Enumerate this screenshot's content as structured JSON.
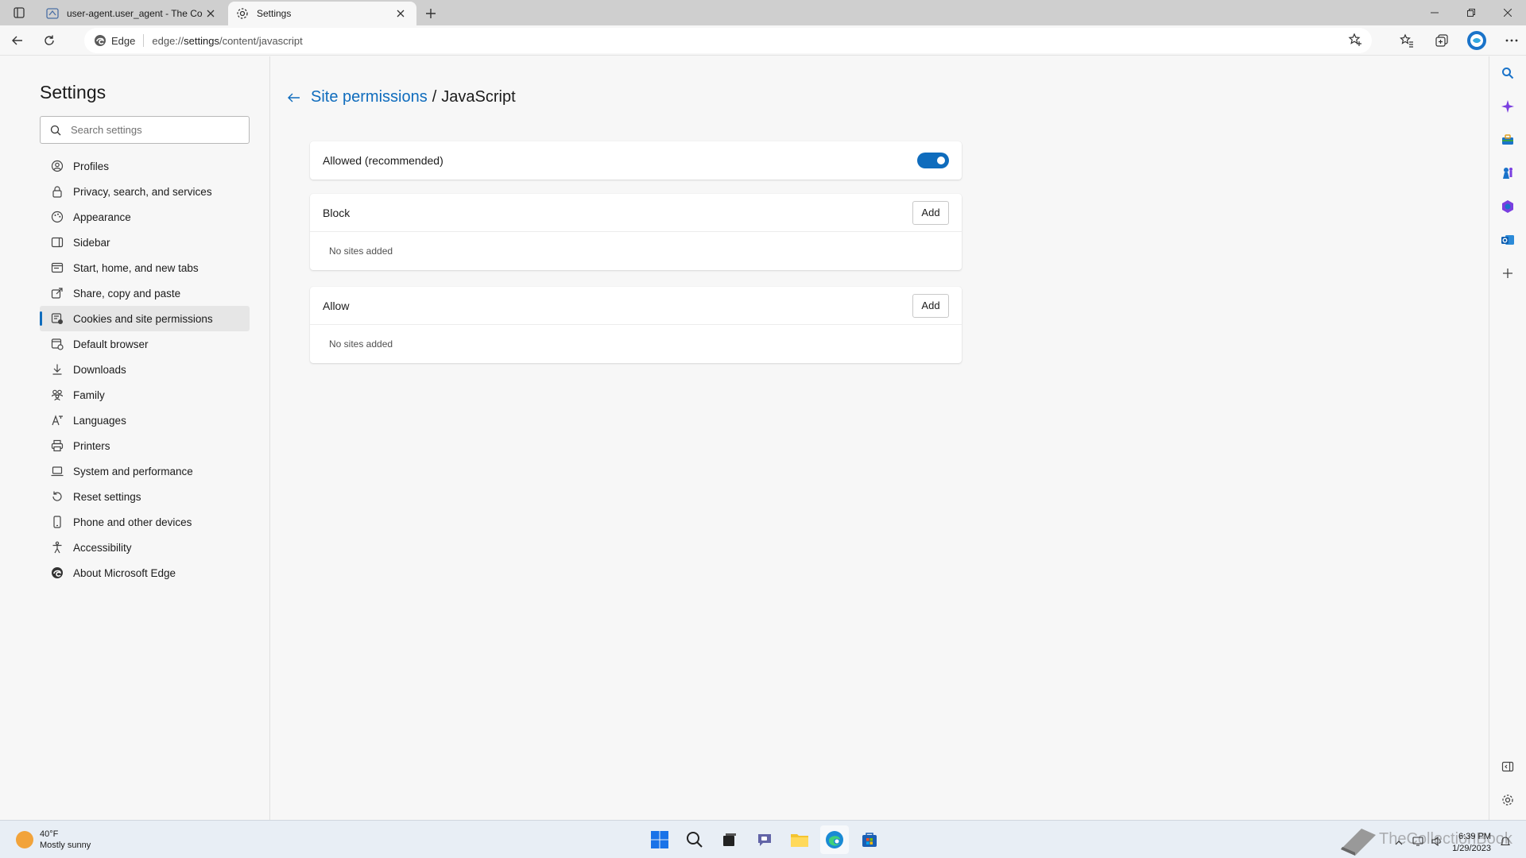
{
  "browser": {
    "tabs": [
      {
        "title": "user-agent.user_agent - The Coll",
        "active": false
      },
      {
        "title": "Settings",
        "active": true
      }
    ],
    "address": {
      "site_label": "Edge",
      "url_prefix": "edge://",
      "url_host": "settings",
      "url_path": "/content/javascript"
    }
  },
  "settings": {
    "title": "Settings",
    "search_placeholder": "Search settings",
    "nav": [
      {
        "label": "Profiles",
        "icon": "profile-icon"
      },
      {
        "label": "Privacy, search, and services",
        "icon": "lock-icon"
      },
      {
        "label": "Appearance",
        "icon": "appearance-icon"
      },
      {
        "label": "Sidebar",
        "icon": "sidebar-icon"
      },
      {
        "label": "Start, home, and new tabs",
        "icon": "home-icon"
      },
      {
        "label": "Share, copy and paste",
        "icon": "share-icon"
      },
      {
        "label": "Cookies and site permissions",
        "icon": "cookies-icon",
        "selected": true
      },
      {
        "label": "Default browser",
        "icon": "browser-icon"
      },
      {
        "label": "Downloads",
        "icon": "download-icon"
      },
      {
        "label": "Family",
        "icon": "family-icon"
      },
      {
        "label": "Languages",
        "icon": "language-icon"
      },
      {
        "label": "Printers",
        "icon": "printer-icon"
      },
      {
        "label": "System and performance",
        "icon": "laptop-icon"
      },
      {
        "label": "Reset settings",
        "icon": "reset-icon"
      },
      {
        "label": "Phone and other devices",
        "icon": "phone-icon"
      },
      {
        "label": "Accessibility",
        "icon": "accessibility-icon"
      },
      {
        "label": "About Microsoft Edge",
        "icon": "edge-icon"
      }
    ]
  },
  "page": {
    "breadcrumb_link": "Site permissions",
    "breadcrumb_sep": "/",
    "breadcrumb_current": "JavaScript",
    "allowed_label": "Allowed (recommended)",
    "allowed_on": true,
    "block": {
      "label": "Block",
      "add_label": "Add",
      "empty": "No sites added"
    },
    "allow": {
      "label": "Allow",
      "add_label": "Add",
      "empty": "No sites added"
    }
  },
  "taskbar": {
    "weather_temp": "40°F",
    "weather_desc": "Mostly sunny",
    "time": "6:39 PM",
    "date": "1/29/2023",
    "watermark": "TheCollectionBook"
  },
  "colors": {
    "accent": "#0f6cbd"
  }
}
